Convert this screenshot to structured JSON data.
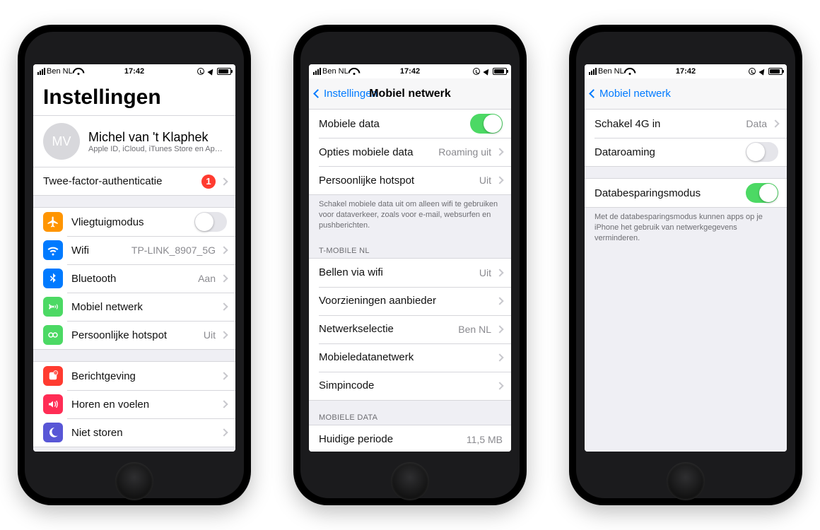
{
  "statusBar": {
    "carrier": "Ben NL",
    "time": "17:42"
  },
  "phone1": {
    "largeTitle": "Instellingen",
    "profile": {
      "initials": "MV",
      "name": "Michel van 't Klaphek",
      "sub": "Apple ID, iCloud, iTunes Store en App S…"
    },
    "twofactor": {
      "label": "Twee-factor-authenticatie",
      "badge": "1"
    },
    "rows1": {
      "airplane": "Vliegtuigmodus",
      "wifi": {
        "label": "Wifi",
        "value": "TP-LINK_8907_5G"
      },
      "bt": {
        "label": "Bluetooth",
        "value": "Aan"
      },
      "mobile": "Mobiel netwerk",
      "hotspot": {
        "label": "Persoonlijke hotspot",
        "value": "Uit"
      }
    },
    "rows2": {
      "notif": "Berichtgeving",
      "sound": "Horen en voelen",
      "dnd": "Niet storen"
    }
  },
  "phone2": {
    "back": "Instellingen",
    "title": "Mobiel netwerk",
    "top": {
      "data": "Mobiele data",
      "opts": {
        "label": "Opties mobiele data",
        "value": "Roaming uit"
      },
      "hotspot": {
        "label": "Persoonlijke hotspot",
        "value": "Uit"
      }
    },
    "footer1": "Schakel mobiele data uit om alleen wifi te gebruiken voor dataverkeer, zoals voor e-mail, websurfen en pushberichten.",
    "carrierHeader": "T-MOBILE NL",
    "carrier": {
      "wificall": {
        "label": "Bellen via wifi",
        "value": "Uit"
      },
      "services": "Voorzieningen aanbieder",
      "netsel": {
        "label": "Netwerkselectie",
        "value": "Ben NL"
      },
      "apn": "Mobieledatanetwerk",
      "sim": "Simpincode"
    },
    "dataHeader": "MOBIELE DATA",
    "period": {
      "label": "Huidige periode",
      "value": "11,5 MB"
    }
  },
  "phone3": {
    "back": "Mobiel netwerk",
    "rows": {
      "enable4g": {
        "label": "Schakel 4G in",
        "value": "Data"
      },
      "roaming": "Dataroaming",
      "lowdata": "Databesparingsmodus"
    },
    "footer": "Met de databesparingsmodus kunnen apps op je iPhone het gebruik van netwerkgegevens verminderen."
  }
}
